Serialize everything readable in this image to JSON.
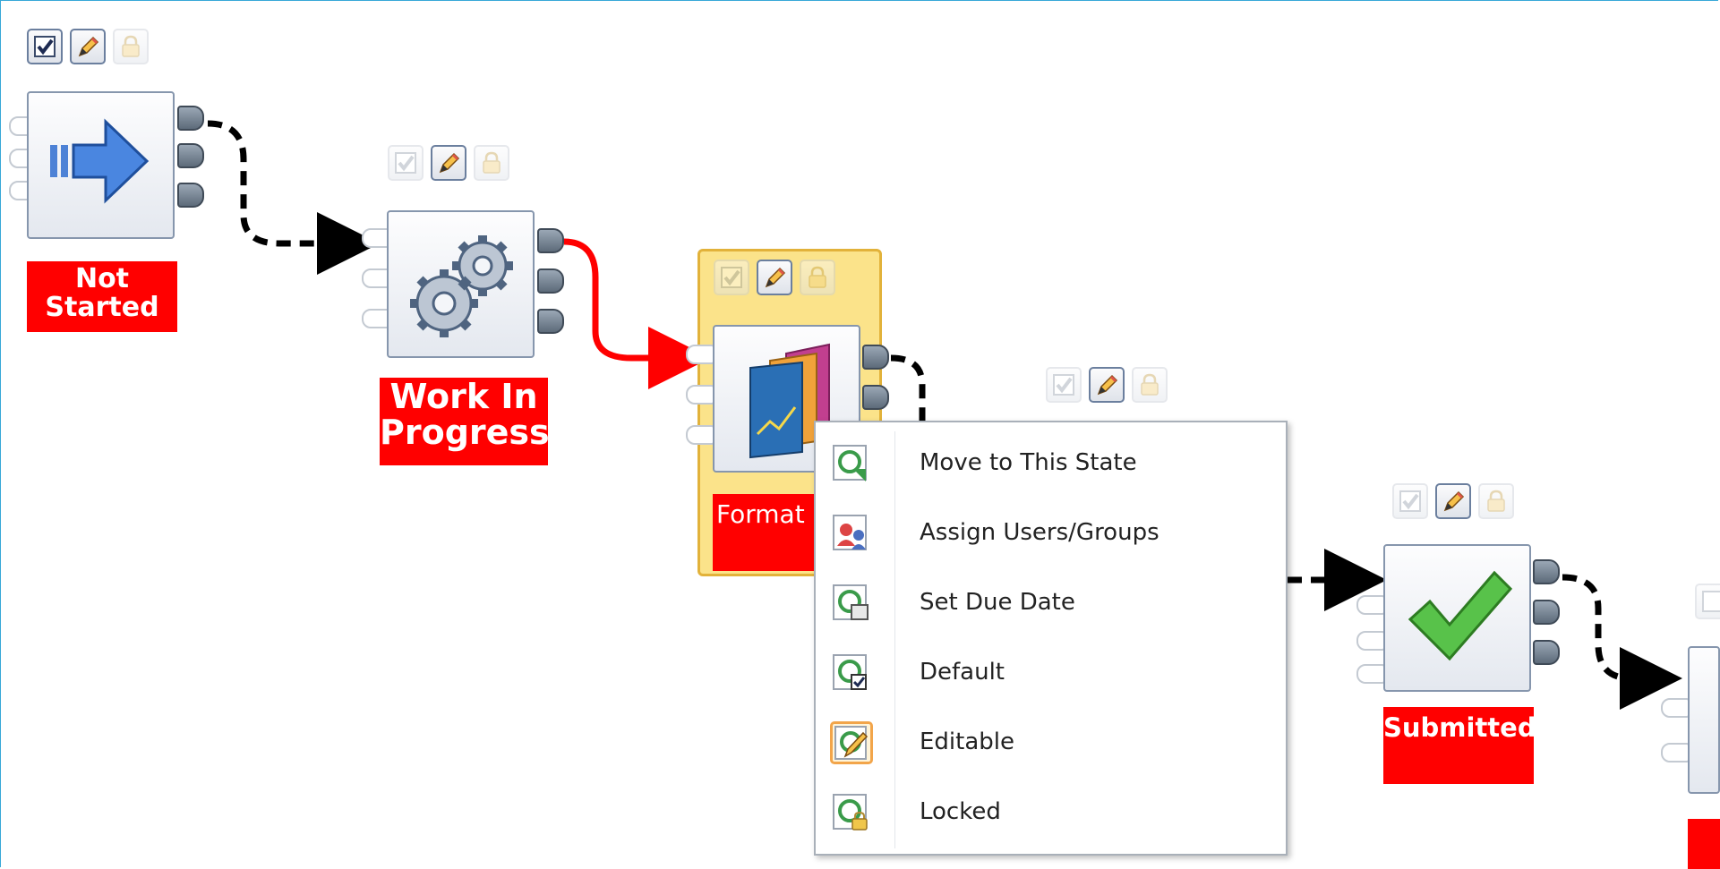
{
  "workflow": {
    "nodes": [
      {
        "id": "not-started",
        "label": "Not Started",
        "label_lines": [
          "Not",
          "Started"
        ],
        "icon": "play-arrow-icon"
      },
      {
        "id": "work-in-progress",
        "label": "Work In Progress",
        "label_lines": [
          "Work In",
          "Progress"
        ],
        "icon": "gears-icon"
      },
      {
        "id": "formatted",
        "label_visible": "Format",
        "icon": "document-stack-icon",
        "selected": true
      },
      {
        "id": "submitted",
        "label": "Submitted",
        "icon": "checkmark-icon"
      },
      {
        "id": "next",
        "label": "",
        "icon": "unknown-icon"
      }
    ],
    "toolbar_icons": [
      "default-checkbox-icon",
      "editable-pencil-icon",
      "locked-padlock-icon"
    ]
  },
  "context_menu": {
    "items": [
      {
        "label": "Move to This State",
        "icon": "move-state-icon"
      },
      {
        "label": "Assign Users/Groups",
        "icon": "assign-users-icon"
      },
      {
        "label": "Set Due Date",
        "icon": "due-date-icon"
      },
      {
        "label": "Default",
        "icon": "default-state-icon"
      },
      {
        "label": "Editable",
        "icon": "editable-state-icon",
        "highlighted": true
      },
      {
        "label": "Locked",
        "icon": "locked-state-icon"
      }
    ]
  },
  "colors": {
    "label_bg": "#ff0000",
    "label_text": "#ffffff",
    "selected_fill": "#fbe38a",
    "selected_border": "#e2b23a",
    "active_connector": "#ff0000",
    "connector": "#000000",
    "frame_border": "#37a8d8"
  }
}
